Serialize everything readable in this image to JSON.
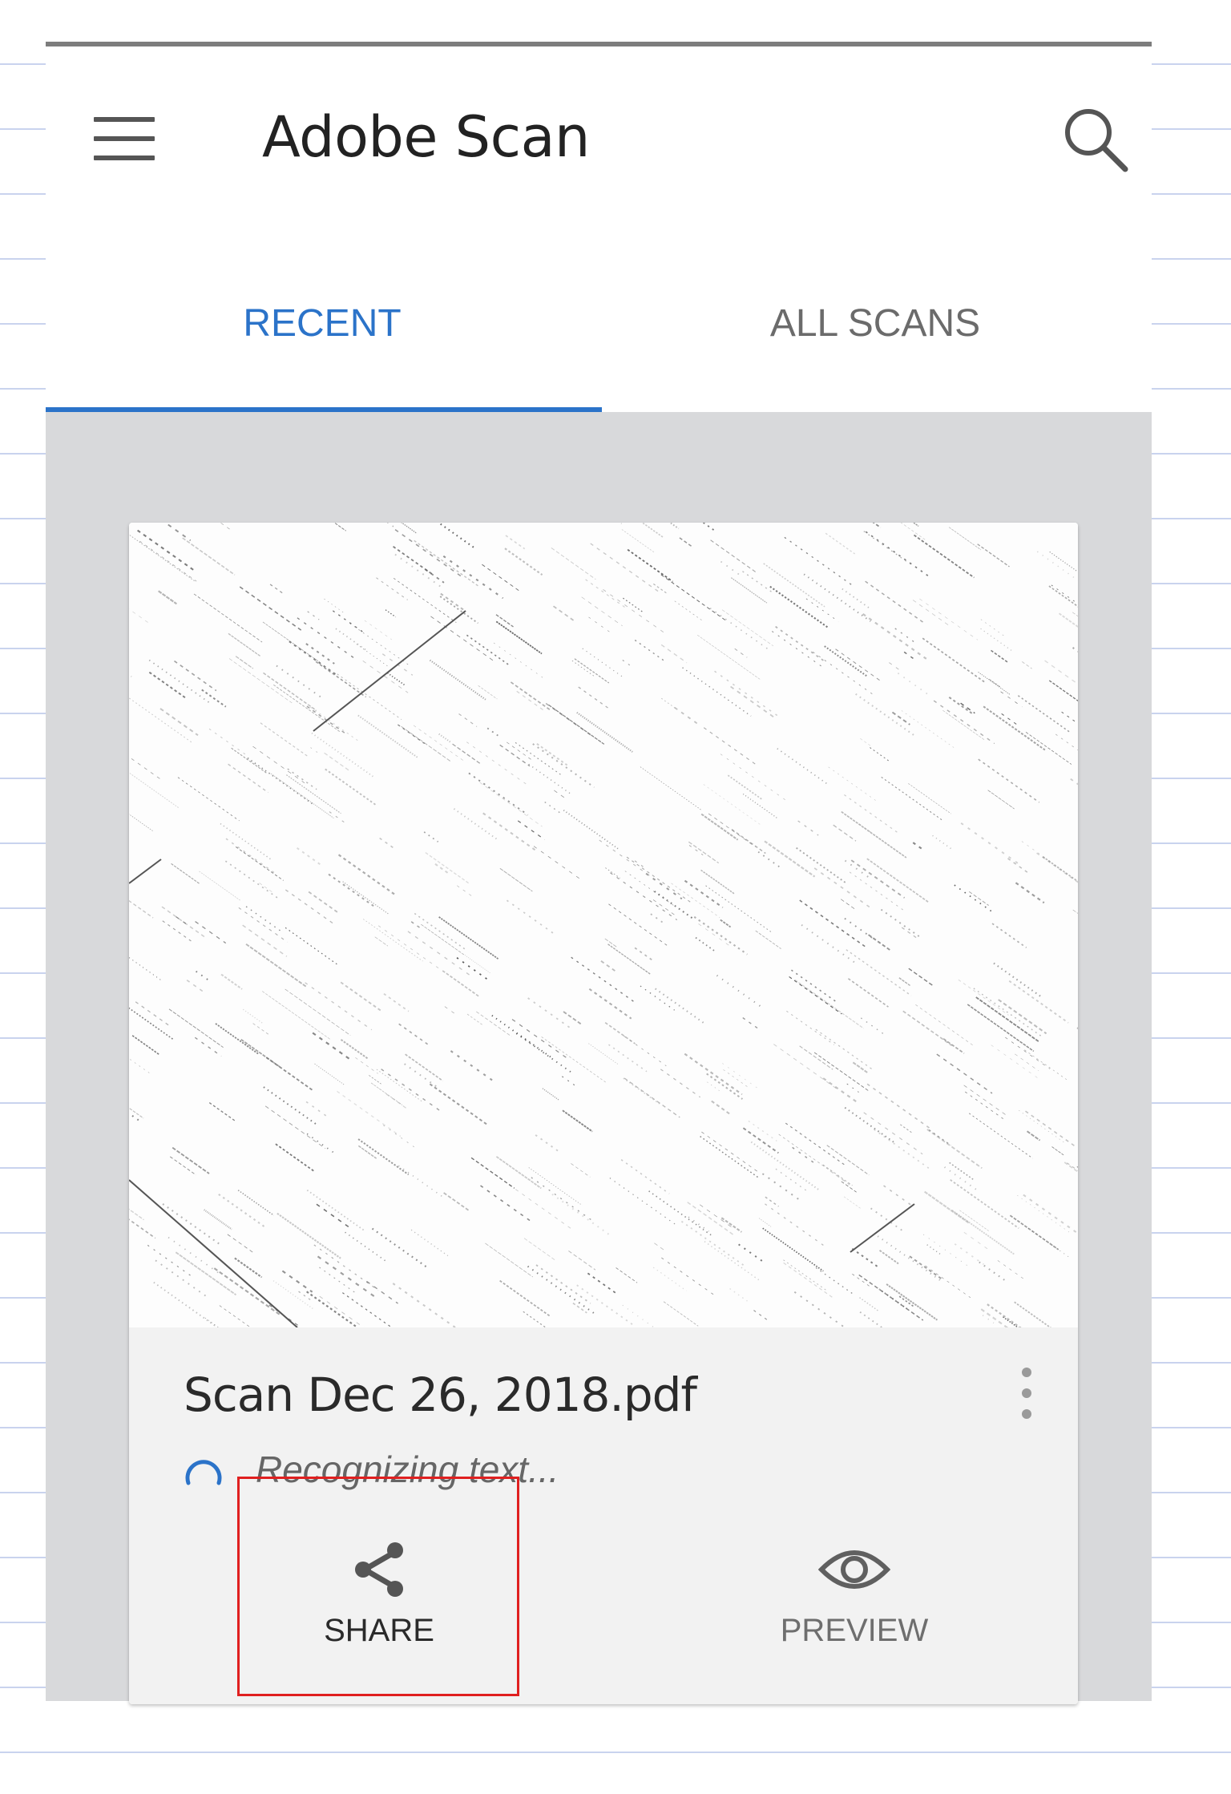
{
  "app": {
    "title": "Adobe Scan",
    "accent_color": "#2b73c9",
    "menu_icon": "hamburger-menu-icon",
    "search_icon": "search-icon"
  },
  "tabs": [
    {
      "label": "RECENT",
      "active": true
    },
    {
      "label": "ALL SCANS",
      "active": false
    }
  ],
  "scan_card": {
    "filename": "Scan Dec 26, 2018.pdf",
    "status": "Recognizing text...",
    "status_icon": "loading-spinner-icon",
    "more_icon": "more-vertical-icon",
    "actions": {
      "share": {
        "label": "SHARE",
        "icon": "share-icon"
      },
      "preview": {
        "label": "PREVIEW",
        "icon": "eye-icon"
      }
    }
  },
  "highlight": {
    "target": "share-button",
    "color": "#e02020"
  }
}
